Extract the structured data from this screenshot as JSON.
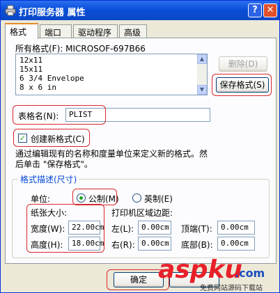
{
  "window": {
    "title": "打印服务器 属性",
    "help_label": "?",
    "close_label": "✕"
  },
  "tabs": [
    {
      "label": "格式"
    },
    {
      "label": "端口"
    },
    {
      "label": "驱动程序"
    },
    {
      "label": "高级"
    }
  ],
  "forms": {
    "label": "所有格式(F): MICROSOF-697B66",
    "items": [
      "12x11",
      "15x11",
      "6 3/4 Envelope",
      "8 x 6 in"
    ],
    "delete_label": "删除(D)",
    "save_label": "保存格式(S)"
  },
  "form_name": {
    "label": "表格名(N):",
    "value": "PLIST"
  },
  "create_new": {
    "label": "创建新格式(C)",
    "checked": true
  },
  "instructions": {
    "line1": "通过编辑现有的名称和度量单位来定义新的格式。然",
    "line2": "后单击 \"保存格式\"。"
  },
  "description": {
    "legend": "格式描述(尺寸)",
    "unit_label": "单位:",
    "metric_label": "公制(M)",
    "english_label": "英制(E)",
    "paper_size_label": "纸张大小:",
    "margins_label": "打印机区域边距:",
    "width_label": "宽度(W):",
    "width_value": "22.00cm",
    "height_label": "高度(H):",
    "height_value": "18.00cm",
    "left_label": "左(L):",
    "left_value": "0.00cm",
    "right_label": "右(R):",
    "right_value": "0.00cm",
    "top_label": "顶端(T):",
    "top_value": "0.00cm",
    "bottom_label": "底部(B):",
    "bottom_value": "0.00cm"
  },
  "footer": {
    "ok_label": "确定"
  },
  "watermark": {
    "brand": "aspku",
    "suffix": ".com",
    "tagline": "免费网站源码下载站"
  },
  "colors": {
    "title_bar": "#0a4fd8",
    "highlight": "#d9282f",
    "watermark_red": "#e8202a",
    "watermark_blue": "#1a4fc0"
  }
}
